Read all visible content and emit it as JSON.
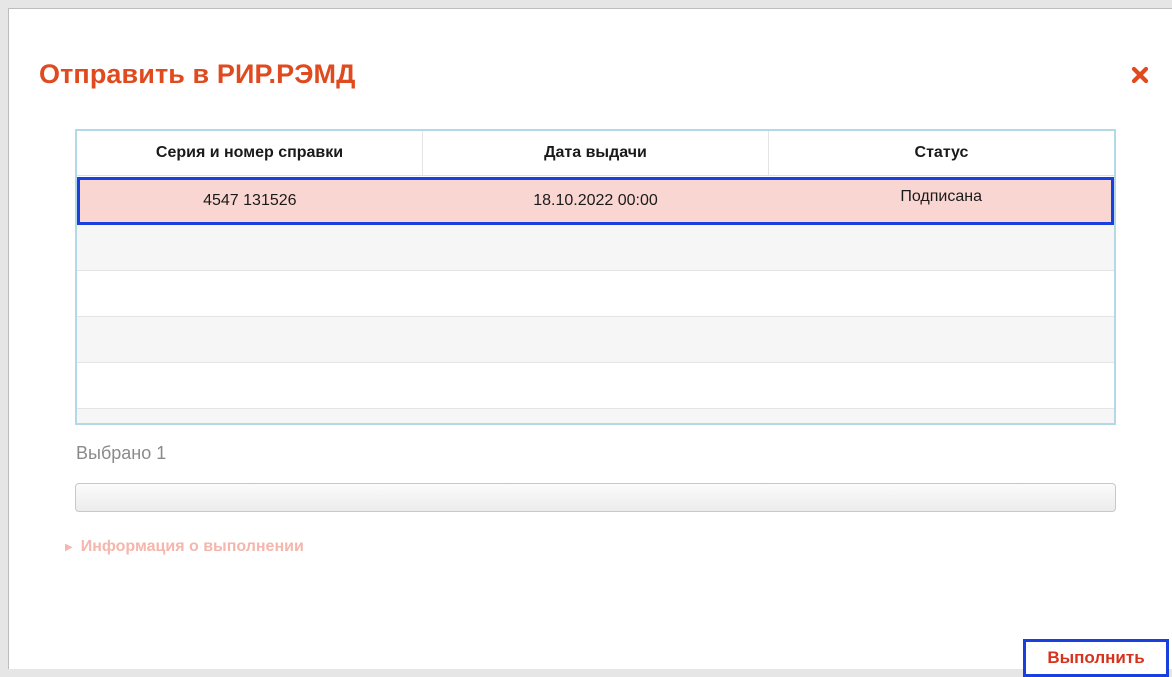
{
  "dialog": {
    "title": "Отправить в РИР.РЭМД",
    "close_icon": "close-icon"
  },
  "table": {
    "columns": [
      "Серия и номер справки",
      "Дата выдачи",
      "Статус"
    ],
    "rows": [
      {
        "series_number": "4547 131526",
        "issue_date": "18.10.2022 00:00",
        "status": "Подписана",
        "selected": true
      }
    ]
  },
  "selected_count": "Выбрано 1",
  "progress": {
    "fraction": 0
  },
  "execution_info": {
    "label": "Информация о выполнении",
    "expand_icon": "triangle-right-icon"
  },
  "actions": {
    "run_label": "Выполнить"
  },
  "colors": {
    "title": "#e04a1f",
    "selected_row": "#f9d6d2",
    "focus_outline": "#1840e0",
    "info_link": "#f4b6ad",
    "run_text": "#d6321c"
  }
}
